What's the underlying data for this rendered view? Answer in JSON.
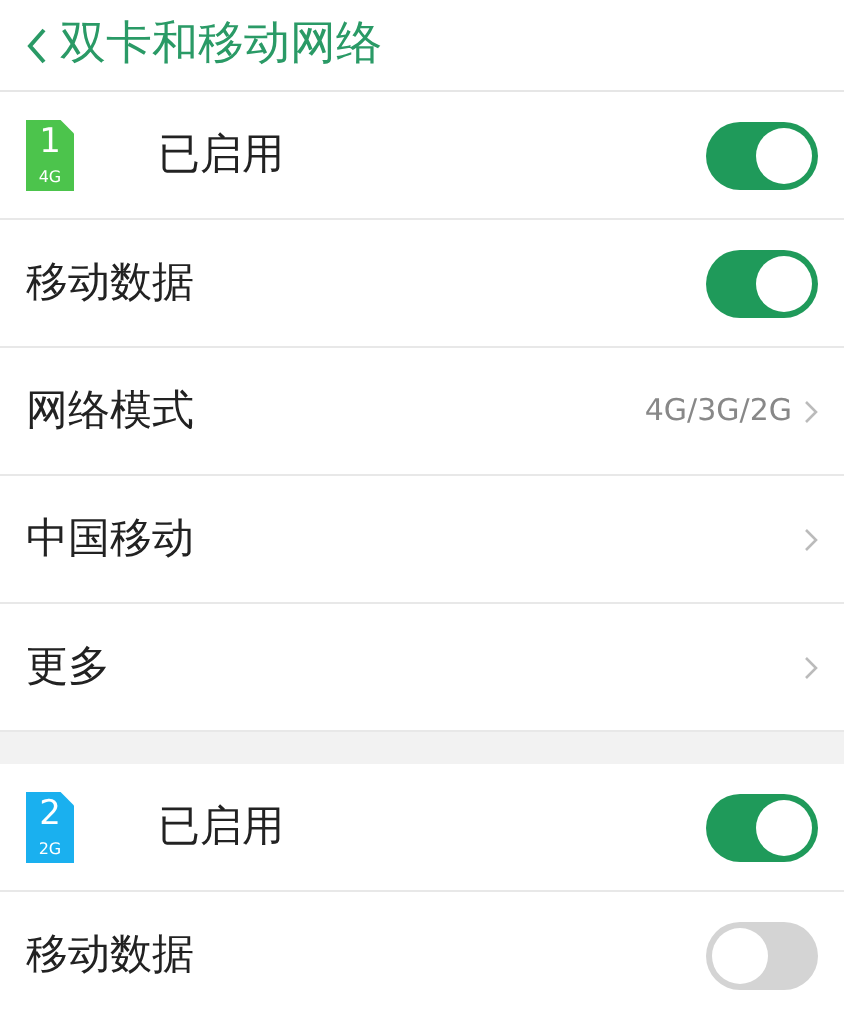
{
  "header": {
    "title": "双卡和移动网络"
  },
  "sections": [
    {
      "rows": [
        {
          "kind": "sim",
          "sim_number": "1",
          "sim_type": "4G",
          "color": "#4cc44c",
          "label": "已启用",
          "on": true
        },
        {
          "kind": "toggle",
          "label": "移动数据",
          "on": true
        },
        {
          "kind": "link",
          "label": "网络模式",
          "value": "4G/3G/2G"
        },
        {
          "kind": "link",
          "label": "中国移动"
        },
        {
          "kind": "link",
          "label": "更多"
        }
      ]
    },
    {
      "rows": [
        {
          "kind": "sim",
          "sim_number": "2",
          "sim_type": "2G",
          "color": "#1ab0ef",
          "label": "已启用",
          "on": true
        },
        {
          "kind": "toggle",
          "label": "移动数据",
          "on": false
        }
      ]
    }
  ]
}
